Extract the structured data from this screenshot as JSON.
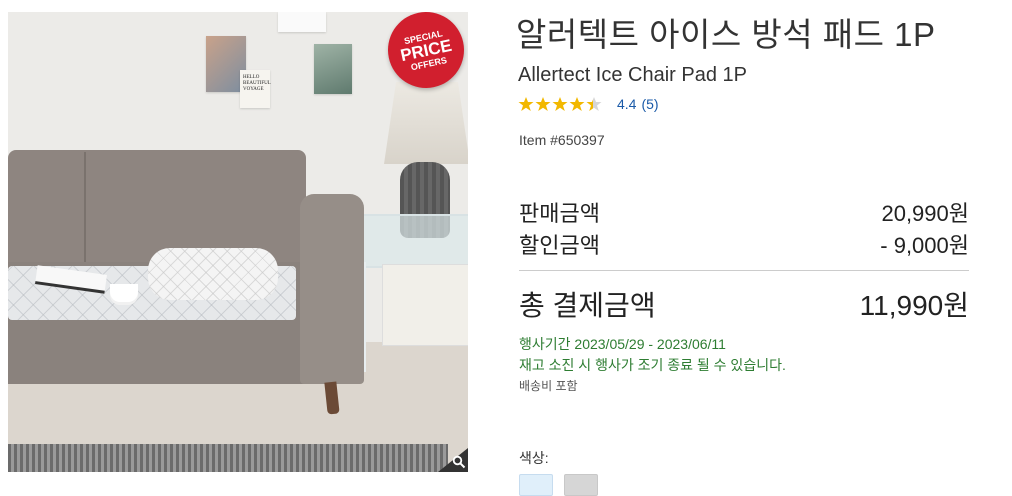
{
  "product": {
    "title_ko": "알러텍트 아이스 방석 패드 1P",
    "title_en": "Allertect Ice Chair Pad 1P",
    "rating_value": "4.4",
    "review_count": "(5)",
    "rating_stars": 4.4,
    "item_number": "Item #650397"
  },
  "image": {
    "badge_line1": "SPECIAL",
    "badge_line2": "PRICE",
    "badge_line3": "OFFERS",
    "poster_text": "HELLO BEAUTIFUL VOYAGE"
  },
  "pricing": {
    "sale_label": "판매금액",
    "sale_value": "20,990원",
    "discount_label": "할인금액",
    "discount_value": "- 9,000원",
    "total_label": "총 결제금액",
    "total_value": "11,990원"
  },
  "promotion": {
    "period": "행사기간 2023/05/29 - 2023/06/11",
    "notice": "재고 소진 시 행사가 조기 종료 될 수 있습니다.",
    "shipping": "배송비 포함"
  },
  "options": {
    "color_label": "색상:",
    "swatches": [
      "light-blue",
      "gray"
    ]
  },
  "colors": {
    "badge": "#d11f2e",
    "star": "#f2b800",
    "link": "#1a5aa8",
    "promo": "#2e7d32"
  },
  "icons": {
    "zoom": "magnifier-icon",
    "star": "star-icon"
  }
}
